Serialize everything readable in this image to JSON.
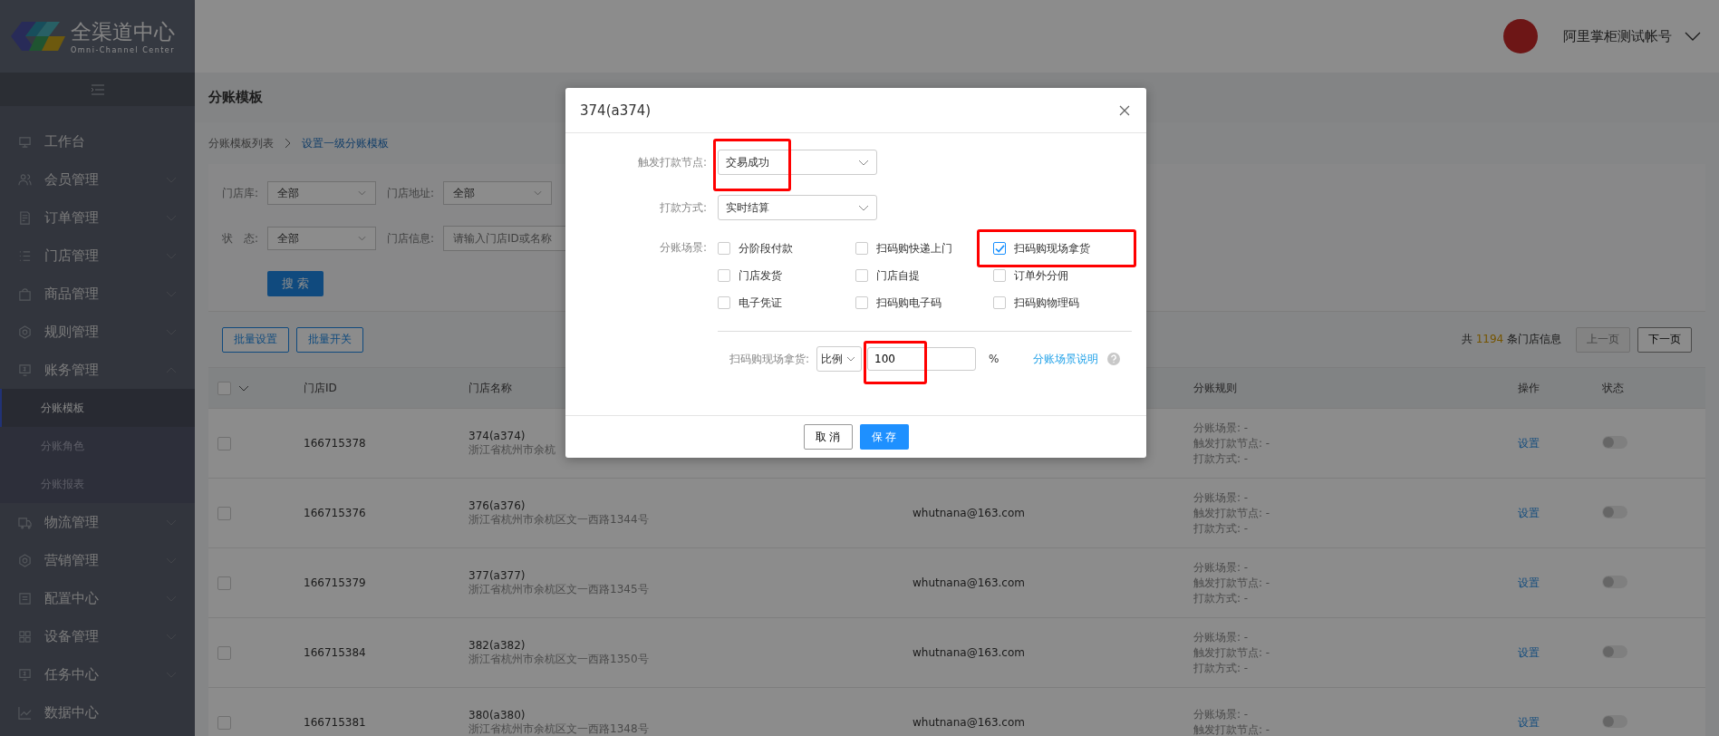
{
  "logo": {
    "title": "全渠道中心",
    "subtitle": "Omni-Channel Center"
  },
  "sidebar": {
    "items": [
      {
        "label": "工作台"
      },
      {
        "label": "会员管理",
        "expanded": false
      },
      {
        "label": "订单管理",
        "expanded": false
      },
      {
        "label": "门店管理",
        "expanded": false
      },
      {
        "label": "商品管理",
        "expanded": false
      },
      {
        "label": "规则管理",
        "expanded": false
      },
      {
        "label": "账务管理",
        "expanded": true,
        "children": [
          {
            "label": "分账模板",
            "selected": true
          },
          {
            "label": "分账角色",
            "selected": false
          },
          {
            "label": "分账报表",
            "selected": false
          }
        ]
      },
      {
        "label": "物流管理",
        "expanded": false
      },
      {
        "label": "营销管理",
        "expanded": false
      },
      {
        "label": "配置中心",
        "expanded": false
      },
      {
        "label": "设备管理",
        "expanded": false
      },
      {
        "label": "任务中心",
        "expanded": false
      },
      {
        "label": "数据中心"
      }
    ]
  },
  "header": {
    "user": "阿里掌柜测试帐号"
  },
  "page": {
    "title": "分账模板",
    "breadcrumb": [
      "分账模板列表",
      "设置一级分账模板"
    ]
  },
  "filters": {
    "rows": [
      [
        {
          "label": "门店库:",
          "value": "全部",
          "kind": "select"
        },
        {
          "label": "门店地址:",
          "value": "全部",
          "kind": "select"
        }
      ],
      [
        {
          "label": "状　态:",
          "value": "全部",
          "kind": "select"
        },
        {
          "label": "门店信息:",
          "placeholder": "请输入门店ID或名称",
          "kind": "input"
        }
      ]
    ],
    "search_button": "搜 索"
  },
  "toolbar": {
    "buttons": [
      "批量设置",
      "批量开关"
    ],
    "total_prefix": "共",
    "total": "1194",
    "total_suffix": "条门店信息",
    "prev": "上一页",
    "next": "下一页",
    "prev_disabled": true
  },
  "table": {
    "select_all_checked": false,
    "columns": [
      "门店ID",
      "门店名称",
      "",
      "分账规则",
      "操作",
      "状态"
    ],
    "rows": [
      {
        "checked": false,
        "id": "166715378",
        "name": "374(a374)",
        "address": "浙江省杭州市余杭",
        "email": "",
        "rules": [
          "分账场景: -",
          "触发打款节点: -",
          "打款方式: -"
        ],
        "action": "设置",
        "on": false
      },
      {
        "checked": false,
        "id": "166715376",
        "name": "376(a376)",
        "address": "浙江省杭州市余杭区文一西路1344号",
        "email": "whutnana@163.com",
        "rules": [
          "分账场景: -",
          "触发打款节点: -",
          "打款方式: -"
        ],
        "action": "设置",
        "on": false
      },
      {
        "checked": false,
        "id": "166715379",
        "name": "377(a377)",
        "address": "浙江省杭州市余杭区文一西路1345号",
        "email": "whutnana@163.com",
        "rules": [
          "分账场景: -",
          "触发打款节点: -",
          "打款方式: -"
        ],
        "action": "设置",
        "on": false
      },
      {
        "checked": false,
        "id": "166715384",
        "name": "382(a382)",
        "address": "浙江省杭州市余杭区文一西路1350号",
        "email": "whutnana@163.com",
        "rules": [
          "分账场景: -",
          "触发打款节点: -",
          "打款方式: -"
        ],
        "action": "设置",
        "on": false
      },
      {
        "checked": false,
        "id": "166715381",
        "name": "380(a380)",
        "address": "浙江省杭州市余杭区文一西路1348号",
        "email": "whutnana@163.com",
        "rules": [
          "分账场景: -",
          "触发打款节点: -"
        ],
        "action": "设置",
        "on": false
      }
    ]
  },
  "dialog": {
    "title": "374(a374)",
    "trigger": {
      "label": "触发打款节点:",
      "value": "交易成功",
      "highlighted": true
    },
    "method": {
      "label": "打款方式:",
      "value": "实时结算"
    },
    "scenes_label": "分账场景:",
    "scenes": [
      {
        "label": "分阶段付款",
        "checked": false,
        "highlighted": false
      },
      {
        "label": "扫码购快递上门",
        "checked": false,
        "highlighted": false
      },
      {
        "label": "扫码购现场拿货",
        "checked": true,
        "highlighted": true
      },
      {
        "label": "门店发货",
        "checked": false,
        "highlighted": false
      },
      {
        "label": "门店自提",
        "checked": false,
        "highlighted": false
      },
      {
        "label": "订单外分佣",
        "checked": false,
        "highlighted": false
      },
      {
        "label": "电子凭证",
        "checked": false,
        "highlighted": false
      },
      {
        "label": "扫码购电子码",
        "checked": false,
        "highlighted": false
      },
      {
        "label": "扫码购物理码",
        "checked": false,
        "highlighted": false
      }
    ],
    "ratio": {
      "label": "扫码购现场拿货:",
      "mode": "比例",
      "value": "100",
      "unit": "%",
      "highlighted": true
    },
    "help_link": "分账场景说明",
    "cancel": "取 消",
    "save": "保 存"
  }
}
